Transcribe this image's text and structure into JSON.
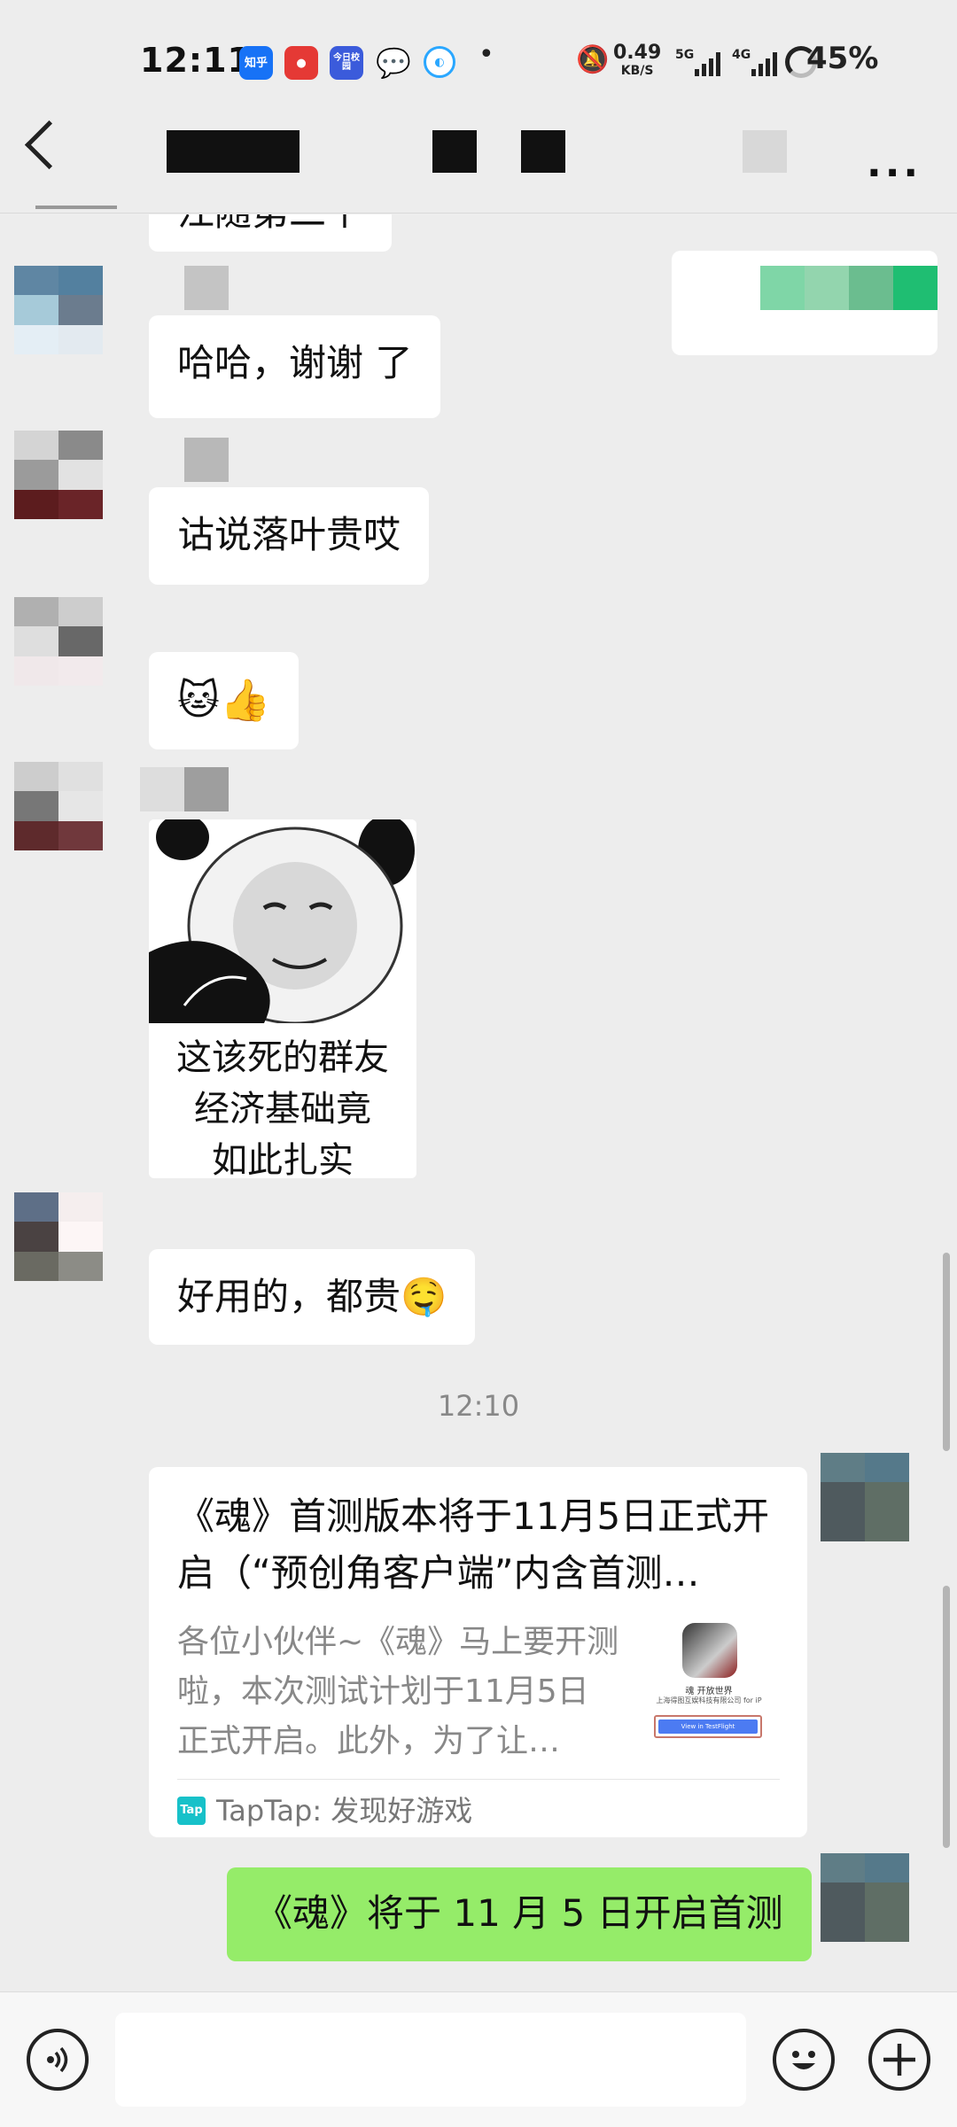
{
  "status_bar": {
    "time": "12:11",
    "apps": [
      "知乎",
      "今日校园"
    ],
    "net_speed": "0.49",
    "net_unit": "KB/S",
    "sim1": "5G",
    "sim2": "4G",
    "battery": "45%"
  },
  "messages": [
    {
      "type": "text",
      "text": "江随第二个"
    },
    {
      "type": "text",
      "text": "哈哈，谢谢 了"
    },
    {
      "type": "text",
      "text": "诂说落叶贵哎"
    },
    {
      "type": "emoji",
      "text": "🐱👍"
    },
    {
      "type": "sticker",
      "caption": [
        "这该死的群友",
        "经济基础竟",
        "如此扎实"
      ]
    },
    {
      "type": "text",
      "text": "好用的，都贵",
      "emoji": "🤤"
    }
  ],
  "timestamp": "12:10",
  "link_card": {
    "title": "《魂》首测版本将于11月5日正式开启（“预创角客户端”内含首测…",
    "description": "各位小伙伴~《魂》马上要开测啦，本次测试计划于11月5日正式开启。此外，为了让…",
    "thumb_title": "魂 开放世界",
    "thumb_company": "上海得图互娱科技有限公司 for iP",
    "thumb_button": "View in TestFlight",
    "source_icon": "Tap",
    "source": "TapTap: 发现好游戏"
  },
  "sent_message": "《魂》将于 11 月 5 日开启首测",
  "input_bar": {
    "placeholder": ""
  },
  "icons": {
    "back": "chevron-left-icon",
    "more": "more-dots-icon",
    "voice": "voice-icon",
    "emoji": "smiley-icon",
    "plus": "plus-icon"
  }
}
